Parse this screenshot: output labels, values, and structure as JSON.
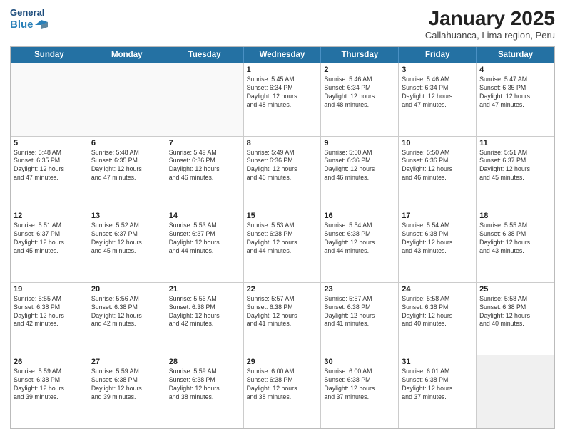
{
  "header": {
    "logo_line1": "General",
    "logo_line2": "Blue",
    "month": "January 2025",
    "location": "Callahuanca, Lima region, Peru"
  },
  "weekdays": [
    "Sunday",
    "Monday",
    "Tuesday",
    "Wednesday",
    "Thursday",
    "Friday",
    "Saturday"
  ],
  "rows": [
    [
      {
        "day": "",
        "text": "",
        "empty": true
      },
      {
        "day": "",
        "text": "",
        "empty": true
      },
      {
        "day": "",
        "text": "",
        "empty": true
      },
      {
        "day": "1",
        "text": "Sunrise: 5:45 AM\nSunset: 6:34 PM\nDaylight: 12 hours\nand 48 minutes."
      },
      {
        "day": "2",
        "text": "Sunrise: 5:46 AM\nSunset: 6:34 PM\nDaylight: 12 hours\nand 48 minutes."
      },
      {
        "day": "3",
        "text": "Sunrise: 5:46 AM\nSunset: 6:34 PM\nDaylight: 12 hours\nand 47 minutes."
      },
      {
        "day": "4",
        "text": "Sunrise: 5:47 AM\nSunset: 6:35 PM\nDaylight: 12 hours\nand 47 minutes."
      }
    ],
    [
      {
        "day": "5",
        "text": "Sunrise: 5:48 AM\nSunset: 6:35 PM\nDaylight: 12 hours\nand 47 minutes."
      },
      {
        "day": "6",
        "text": "Sunrise: 5:48 AM\nSunset: 6:35 PM\nDaylight: 12 hours\nand 47 minutes."
      },
      {
        "day": "7",
        "text": "Sunrise: 5:49 AM\nSunset: 6:36 PM\nDaylight: 12 hours\nand 46 minutes."
      },
      {
        "day": "8",
        "text": "Sunrise: 5:49 AM\nSunset: 6:36 PM\nDaylight: 12 hours\nand 46 minutes."
      },
      {
        "day": "9",
        "text": "Sunrise: 5:50 AM\nSunset: 6:36 PM\nDaylight: 12 hours\nand 46 minutes."
      },
      {
        "day": "10",
        "text": "Sunrise: 5:50 AM\nSunset: 6:36 PM\nDaylight: 12 hours\nand 46 minutes."
      },
      {
        "day": "11",
        "text": "Sunrise: 5:51 AM\nSunset: 6:37 PM\nDaylight: 12 hours\nand 45 minutes."
      }
    ],
    [
      {
        "day": "12",
        "text": "Sunrise: 5:51 AM\nSunset: 6:37 PM\nDaylight: 12 hours\nand 45 minutes."
      },
      {
        "day": "13",
        "text": "Sunrise: 5:52 AM\nSunset: 6:37 PM\nDaylight: 12 hours\nand 45 minutes."
      },
      {
        "day": "14",
        "text": "Sunrise: 5:53 AM\nSunset: 6:37 PM\nDaylight: 12 hours\nand 44 minutes."
      },
      {
        "day": "15",
        "text": "Sunrise: 5:53 AM\nSunset: 6:38 PM\nDaylight: 12 hours\nand 44 minutes."
      },
      {
        "day": "16",
        "text": "Sunrise: 5:54 AM\nSunset: 6:38 PM\nDaylight: 12 hours\nand 44 minutes."
      },
      {
        "day": "17",
        "text": "Sunrise: 5:54 AM\nSunset: 6:38 PM\nDaylight: 12 hours\nand 43 minutes."
      },
      {
        "day": "18",
        "text": "Sunrise: 5:55 AM\nSunset: 6:38 PM\nDaylight: 12 hours\nand 43 minutes."
      }
    ],
    [
      {
        "day": "19",
        "text": "Sunrise: 5:55 AM\nSunset: 6:38 PM\nDaylight: 12 hours\nand 42 minutes."
      },
      {
        "day": "20",
        "text": "Sunrise: 5:56 AM\nSunset: 6:38 PM\nDaylight: 12 hours\nand 42 minutes."
      },
      {
        "day": "21",
        "text": "Sunrise: 5:56 AM\nSunset: 6:38 PM\nDaylight: 12 hours\nand 42 minutes."
      },
      {
        "day": "22",
        "text": "Sunrise: 5:57 AM\nSunset: 6:38 PM\nDaylight: 12 hours\nand 41 minutes."
      },
      {
        "day": "23",
        "text": "Sunrise: 5:57 AM\nSunset: 6:38 PM\nDaylight: 12 hours\nand 41 minutes."
      },
      {
        "day": "24",
        "text": "Sunrise: 5:58 AM\nSunset: 6:38 PM\nDaylight: 12 hours\nand 40 minutes."
      },
      {
        "day": "25",
        "text": "Sunrise: 5:58 AM\nSunset: 6:38 PM\nDaylight: 12 hours\nand 40 minutes."
      }
    ],
    [
      {
        "day": "26",
        "text": "Sunrise: 5:59 AM\nSunset: 6:38 PM\nDaylight: 12 hours\nand 39 minutes."
      },
      {
        "day": "27",
        "text": "Sunrise: 5:59 AM\nSunset: 6:38 PM\nDaylight: 12 hours\nand 39 minutes."
      },
      {
        "day": "28",
        "text": "Sunrise: 5:59 AM\nSunset: 6:38 PM\nDaylight: 12 hours\nand 38 minutes."
      },
      {
        "day": "29",
        "text": "Sunrise: 6:00 AM\nSunset: 6:38 PM\nDaylight: 12 hours\nand 38 minutes."
      },
      {
        "day": "30",
        "text": "Sunrise: 6:00 AM\nSunset: 6:38 PM\nDaylight: 12 hours\nand 37 minutes."
      },
      {
        "day": "31",
        "text": "Sunrise: 6:01 AM\nSunset: 6:38 PM\nDaylight: 12 hours\nand 37 minutes."
      },
      {
        "day": "",
        "text": "",
        "empty": true,
        "shaded": true
      }
    ]
  ]
}
